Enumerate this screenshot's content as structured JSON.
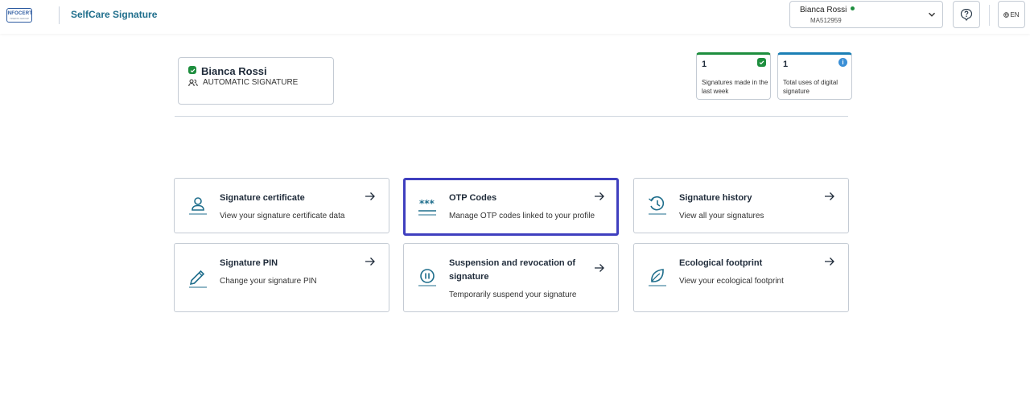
{
  "header": {
    "logo_text": "INFOCERT",
    "logo_subtext": "TINEXTA GROUP",
    "app_title": "SelfCare Signature",
    "user_name": "Bianca Rossi",
    "user_code": "MA512959",
    "language": "EN"
  },
  "profile": {
    "name": "Bianca Rossi",
    "role": "AUTOMATIC SIGNATURE"
  },
  "stats": [
    {
      "value": "1",
      "label": "Signatures made in the last week",
      "accent": "#1e8e3e"
    },
    {
      "value": "1",
      "label": "Total uses of digital signature",
      "accent": "#1b7fb5"
    }
  ],
  "tiles": [
    {
      "title": "Signature certificate",
      "desc": "View your signature certificate data",
      "icon": "person-icon"
    },
    {
      "title": "OTP Codes",
      "desc": "Manage OTP codes linked to your profile",
      "icon": "otp-icon",
      "selected": true
    },
    {
      "title": "Signature history",
      "desc": "View all your signatures",
      "icon": "history-icon"
    },
    {
      "title": "Signature PIN",
      "desc": "Change your signature PIN",
      "icon": "pencil-icon"
    },
    {
      "title": "Suspension and revocation of signature",
      "desc": "Temporarily suspend your signature",
      "icon": "pause-icon"
    },
    {
      "title": "Ecological footprint",
      "desc": "View your ecological footprint",
      "icon": "leaf-icon"
    }
  ],
  "colors": {
    "primary": "#1f6e8c",
    "success": "#1e8e3e",
    "info": "#1b7fb5",
    "focus": "#3f3fbf"
  }
}
